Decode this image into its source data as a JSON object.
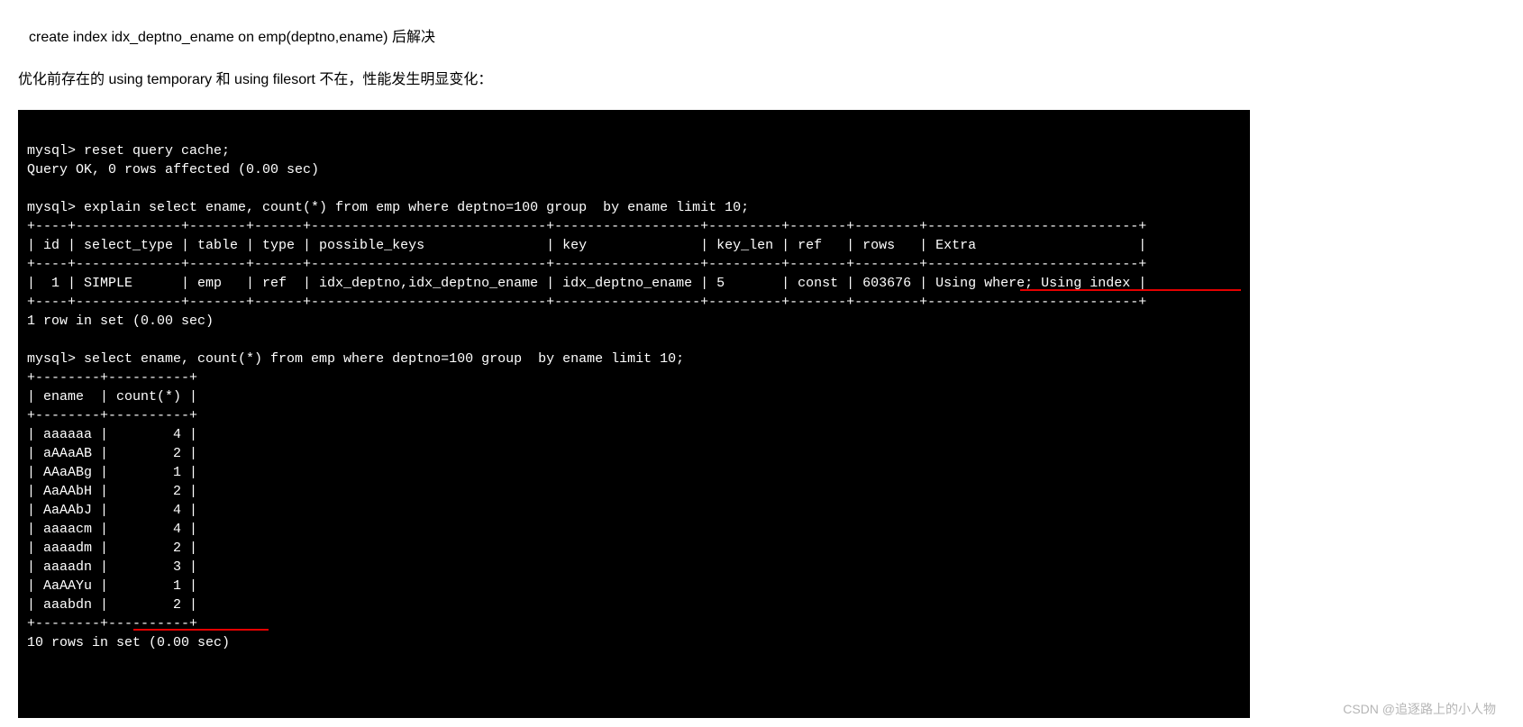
{
  "text": {
    "line1": " create index idx_deptno_ename on emp(deptno,ename) 后解决",
    "line2": "优化前存在的 using  temporary 和 using  filesort 不在，性能发生明显变化："
  },
  "terminal": {
    "l01": "mysql> reset query cache;",
    "l02": "Query OK, 0 rows affected (0.00 sec)",
    "l03": "",
    "l04": "mysql> explain select ename, count(*) from emp where deptno=100 group  by ename limit 10;",
    "l05": "+----+-------------+-------+------+-----------------------------+------------------+---------+-------+--------+--------------------------+",
    "l06": "| id | select_type | table | type | possible_keys               | key              | key_len | ref   | rows   | Extra                    |",
    "l07": "+----+-------------+-------+------+-----------------------------+------------------+---------+-------+--------+--------------------------+",
    "l08": "|  1 | SIMPLE      | emp   | ref  | idx_deptno,idx_deptno_ename | idx_deptno_ename | 5       | const | 603676 | Using where; Using index |",
    "l09": "+----+-------------+-------+------+-----------------------------+------------------+---------+-------+--------+--------------------------+",
    "l10": "1 row in set (0.00 sec)",
    "l11": "",
    "l12": "mysql> select ename, count(*) from emp where deptno=100 group  by ename limit 10;",
    "l13": "+--------+----------+",
    "l14": "| ename  | count(*) |",
    "l15": "+--------+----------+",
    "l16": "| aaaaaa |        4 |",
    "l17": "| aAAaAB |        2 |",
    "l18": "| AAaABg |        1 |",
    "l19": "| AaAAbH |        2 |",
    "l20": "| AaAAbJ |        4 |",
    "l21": "| aaaacm |        4 |",
    "l22": "| aaaadm |        2 |",
    "l23": "| aaaadn |        3 |",
    "l24": "| AaAAYu |        1 |",
    "l25": "| aaabdn |        2 |",
    "l26": "+--------+----------+",
    "l27": "10 rows in set (0.00 sec)"
  },
  "watermark": "CSDN @追逐路上的小人物",
  "chart_data": {
    "type": "table",
    "explain_result": {
      "columns": [
        "id",
        "select_type",
        "table",
        "type",
        "possible_keys",
        "key",
        "key_len",
        "ref",
        "rows",
        "Extra"
      ],
      "rows": [
        [
          1,
          "SIMPLE",
          "emp",
          "ref",
          "idx_deptno,idx_deptno_ename",
          "idx_deptno_ename",
          5,
          "const",
          603676,
          "Using where; Using index"
        ]
      ],
      "summary": "1 row in set (0.00 sec)"
    },
    "query_result": {
      "columns": [
        "ename",
        "count(*)"
      ],
      "rows": [
        [
          "aaaaaa",
          4
        ],
        [
          "aAAaAB",
          2
        ],
        [
          "AAaABg",
          1
        ],
        [
          "AaAAbH",
          2
        ],
        [
          "AaAAbJ",
          4
        ],
        [
          "aaaacm",
          4
        ],
        [
          "aaaadm",
          2
        ],
        [
          "aaaadn",
          3
        ],
        [
          "AaAAYu",
          1
        ],
        [
          "aaabdn",
          2
        ]
      ],
      "summary": "10 rows in set (0.00 sec)"
    }
  }
}
